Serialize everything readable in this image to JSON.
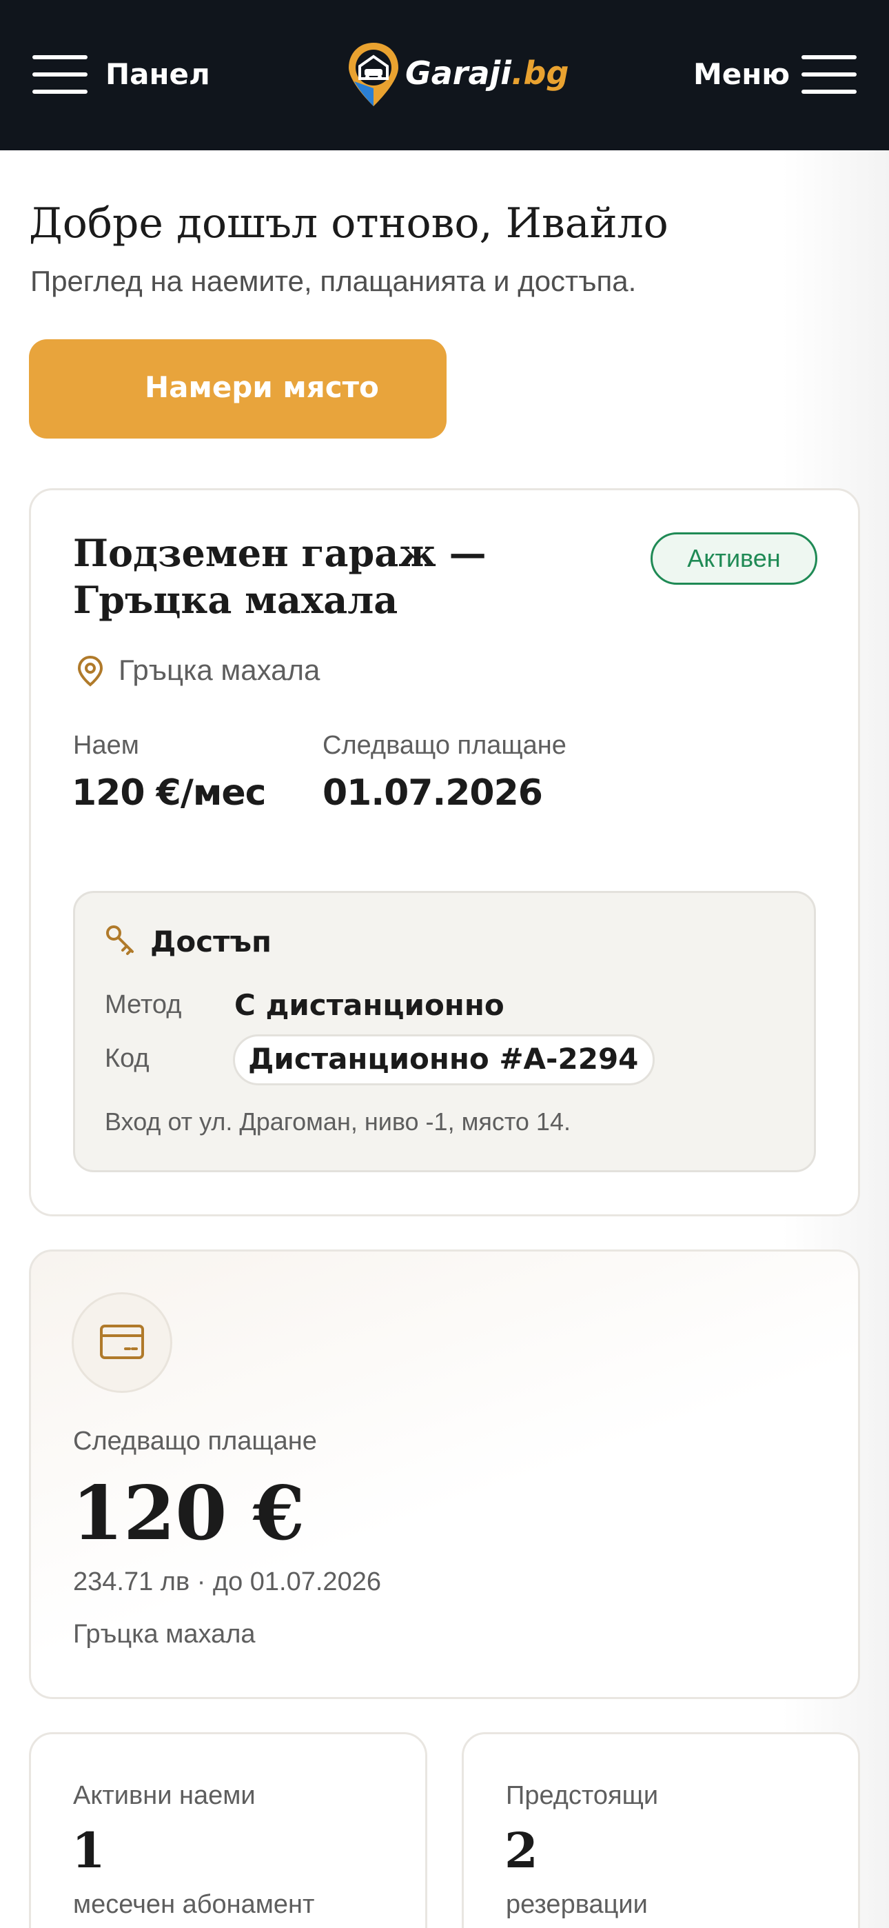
{
  "header": {
    "panel_label": "Панел",
    "menu_label": "Меню",
    "logo_name": "Garaji",
    "logo_tld": ".bg",
    "bg_color": "#10151c",
    "accent_color": "#e9a230"
  },
  "welcome": {
    "title": "Добре дошъл отново, Ивайло",
    "subtitle": "Преглед на наемите, плащанията и достъпа."
  },
  "search_button": {
    "label": "Намери място",
    "icon": "search-icon",
    "color": "#e8a43c"
  },
  "rental": {
    "title": "Подземен гараж — Гръцка махала",
    "status": "Активен",
    "status_color": "#1f8a55",
    "location": "Гръцка махала",
    "rent_label": "Наем",
    "rent_value": "120 €/мес",
    "next_payment_label": "Следващо плащане",
    "next_payment_date": "01.07.2026",
    "access": {
      "title": "Достъп",
      "method_label": "Метод",
      "method_value": "С дистанционно",
      "code_label": "Код",
      "code_value": "Дистанционно #A-2294",
      "note": "Вход от ул. Драгоман, ниво -1, място 14."
    }
  },
  "payment": {
    "label": "Следващо плащане",
    "amount": "120 €",
    "details": "234.71 лв · до 01.07.2026",
    "location": "Гръцка махала"
  },
  "stats": [
    {
      "label": "Активни наеми",
      "value": "1",
      "sub": "месечен абонамент"
    },
    {
      "label": "Предстоящи",
      "value": "2",
      "sub": "резервации"
    }
  ]
}
